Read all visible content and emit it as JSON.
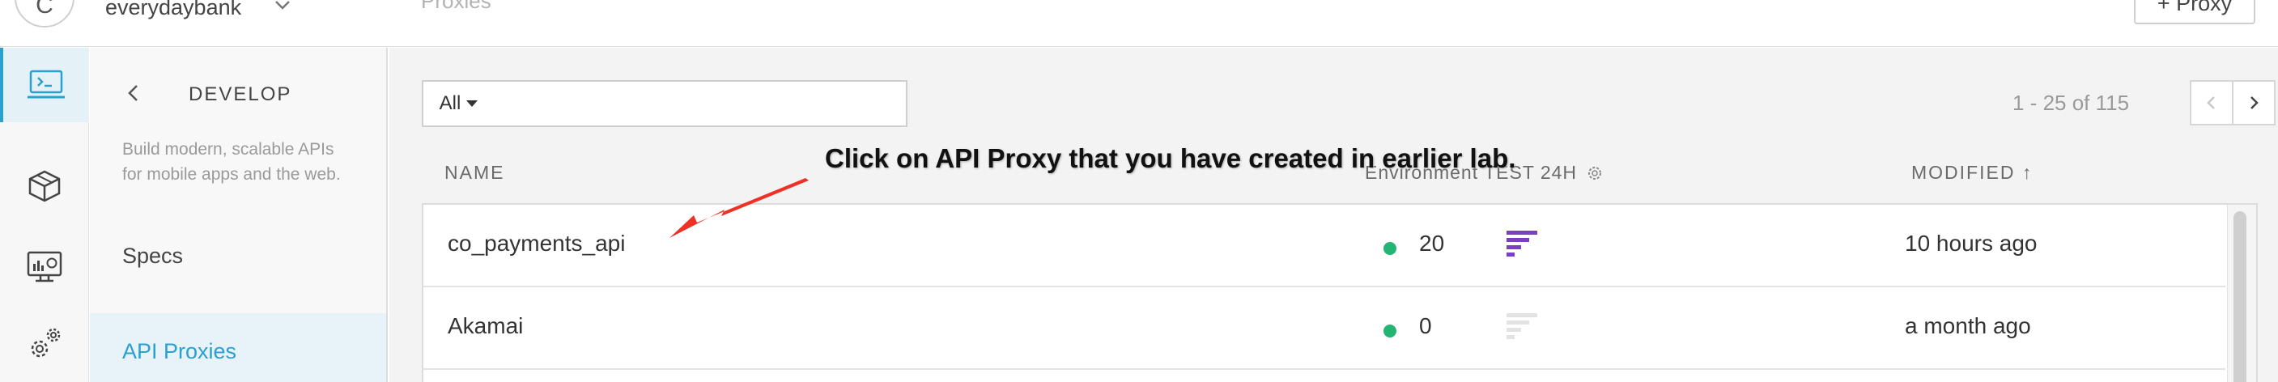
{
  "header": {
    "org_initial": "C",
    "org_name": "everydaybank",
    "breadcrumb": "Proxies",
    "action_button": "+ Proxy"
  },
  "rail": {
    "items": [
      {
        "icon": "develop-console-icon",
        "active": true
      },
      {
        "icon": "publish-box-icon",
        "active": false
      },
      {
        "icon": "analyze-monitor-icon",
        "active": false
      },
      {
        "icon": "admin-gears-icon",
        "active": false
      }
    ]
  },
  "nav": {
    "title": "DEVELOP",
    "description": "Build modern, scalable APIs for mobile apps and the web.",
    "specs_label": "Specs",
    "proxies_label": "API Proxies"
  },
  "filter": {
    "select_value": "All",
    "search_value": ""
  },
  "pager": {
    "summary": "1 - 25 of 115"
  },
  "table": {
    "col_name": "NAME",
    "col_env": "Environment TEST 24H",
    "col_modified": "MODIFIED ↑",
    "rows": [
      {
        "name": "co_payments_api",
        "count": "20",
        "modified": "10 hours ago",
        "status_color": "#22b573",
        "chart_color": "#7b3fc4"
      },
      {
        "name": "Akamai",
        "count": "0",
        "modified": "a month ago",
        "status_color": "#22b573",
        "chart_color": "#e3e3e3"
      }
    ]
  },
  "annotation": {
    "text": "Click on API Proxy that you have created in earlier lab.",
    "arrow_color": "#ee3124"
  }
}
